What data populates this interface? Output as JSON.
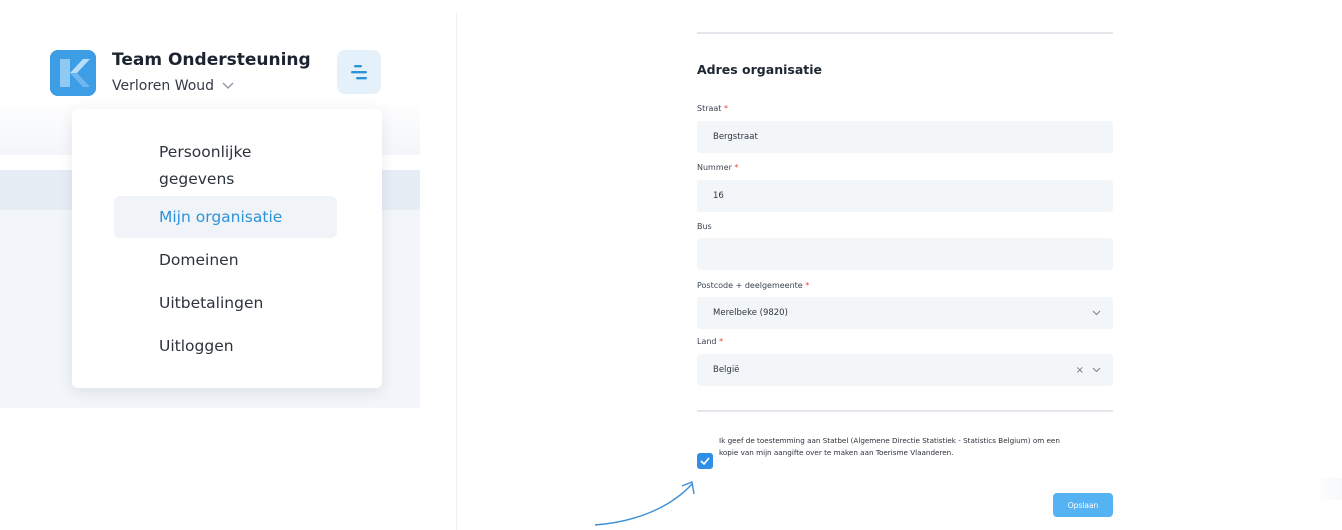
{
  "sidebar": {
    "team_name": "Team Ondersteuning",
    "location": "Verloren Woud",
    "logo_icon": "k-logo",
    "menu_icon": "hamburger-menu-icon",
    "accent_color": "#2e92d9",
    "menu": [
      {
        "label": "Persoonlijke"
      },
      {
        "label": "gegevens"
      },
      {
        "label": "Mijn organisatie",
        "active": true
      },
      {
        "label": "Domeinen"
      },
      {
        "label": "Uitbetalingen"
      },
      {
        "label": "Uitloggen"
      }
    ]
  },
  "form": {
    "section_title": "Adres organisatie",
    "fields": {
      "straat": {
        "label": "Straat",
        "required_mark": "*",
        "value": "Bergstraat"
      },
      "nummer": {
        "label": "Nummer",
        "required_mark": "*",
        "value": "16"
      },
      "bus": {
        "label": "Bus",
        "value": ""
      },
      "postcode": {
        "label": "Postcode + deelgemeente",
        "required_mark": "*",
        "value": "Merelbeke (9820)"
      },
      "land": {
        "label": "Land",
        "required_mark": "*",
        "value": "België",
        "clear_glyph": "×"
      }
    },
    "consent": {
      "checked": true,
      "text": "Ik geef de toestemming aan Statbel (Algemene Directie Statistiek - Statistics Belgium) om een kopie van mijn aangifte over te maken aan Toerisme Vlaanderen."
    },
    "save_label": "Opslaan",
    "checkbox_color": "#2f8fe6",
    "button_color": "#55b2f3"
  }
}
